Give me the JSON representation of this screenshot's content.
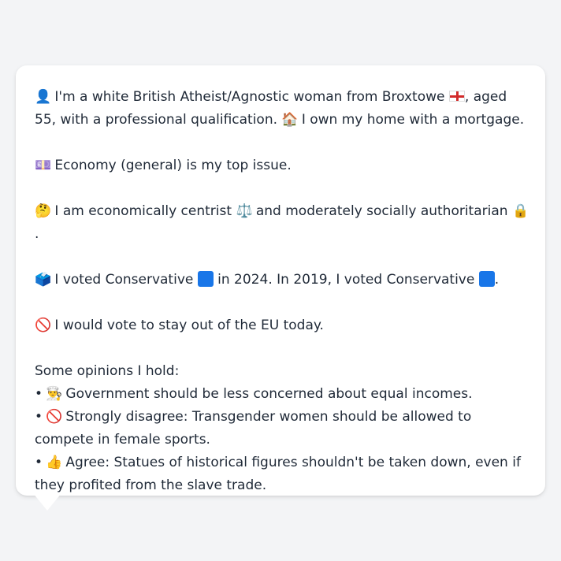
{
  "profile": {
    "line1_a": "I'm a white British Atheist/Agnostic woman from Broxtowe",
    "line1_b": ", aged 55, with a professional qualification.",
    "line1_c": "I own my home with a mortgage.",
    "issue": "Economy (general) is my top issue.",
    "stance_a": "I am economically centrist",
    "stance_b": "and moderately socially authoritarian",
    "stance_end": ".",
    "vote_a": "I voted Conservative",
    "vote_b": "in 2024. In 2019, I voted Conservative",
    "vote_end": ".",
    "eu": "I would vote to stay out of the EU today.",
    "opinions_header": "Some opinions I hold:",
    "opinions": [
      "Government should be less concerned about equal incomes.",
      "Strongly disagree: Transgender women should be allowed to compete in female sports.",
      "Agree: Statues of historical figures shouldn't be taken down, even if they profited from the slave trade."
    ],
    "bullet": "•"
  },
  "icons": {
    "person": "👤",
    "home": "🏠",
    "money": "💷",
    "thinking": "🤔",
    "scales": "⚖️",
    "lock": "🔒",
    "ballot": "🗳️",
    "no_entry": "🚫",
    "chef": "👨‍🍳",
    "thumbs_up": "👍"
  }
}
